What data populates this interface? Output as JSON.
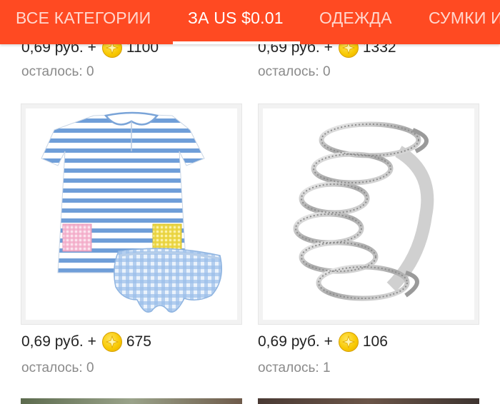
{
  "tabs": [
    {
      "label": "ВСЕ КАТЕГОРИИ",
      "active": false
    },
    {
      "label": "ЗА US $0.01",
      "active": true
    },
    {
      "label": "ОДЕЖДА",
      "active": false
    },
    {
      "label": "СУМКИ И",
      "active": false
    }
  ],
  "colors": {
    "accent": "#ff4a22",
    "coin": "#f8c800"
  },
  "top_items": [
    {
      "price": "0,69 руб. +",
      "coins": "1100",
      "left_label": "осталось: 0"
    },
    {
      "price": "0,69 руб. +",
      "coins": "1332",
      "left_label": "осталось: 0"
    }
  ],
  "products": [
    {
      "image": "baby-dress-set",
      "price": "0,69 руб. +",
      "coins": "675",
      "left_label": "осталось: 0"
    },
    {
      "image": "silver-cuff-bracelet",
      "price": "0,69 руб. +",
      "coins": "106",
      "left_label": "осталось: 1"
    }
  ],
  "coin_icon": "coin-icon"
}
